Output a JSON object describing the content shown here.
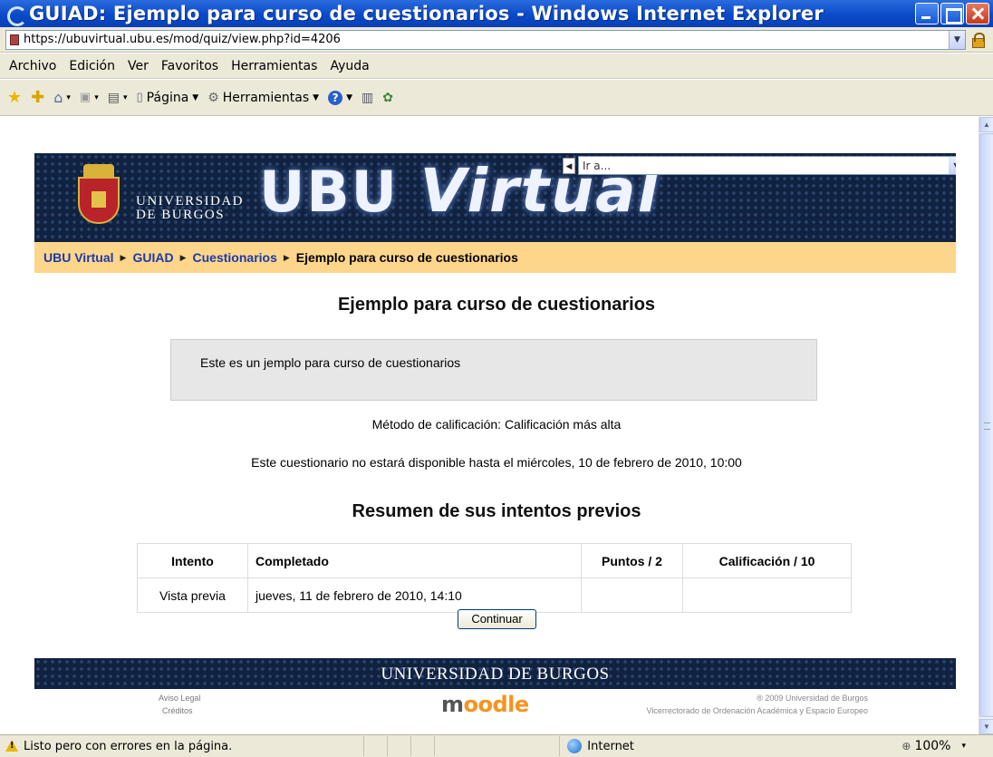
{
  "window": {
    "title": "GUIAD: Ejemplo para curso de cuestionarios - Windows Internet Explorer"
  },
  "address": {
    "url": "https://ubuvirtual.ubu.es/mod/quiz/view.php?id=4206"
  },
  "menu": [
    "Archivo",
    "Edición",
    "Ver",
    "Favoritos",
    "Herramientas",
    "Ayuda"
  ],
  "toolbar": {
    "page_label": "Página",
    "tools_label": "Herramientas"
  },
  "header": {
    "university_line1": "UNIVERSIDAD",
    "university_line2": "DE BURGOS",
    "logo_part1": "UBU",
    "logo_part2": "Virtual",
    "goto_placeholder": "Ir a..."
  },
  "breadcrumb": {
    "items": [
      "UBU Virtual",
      "GUIAD",
      "Cuestionarios"
    ],
    "current": "Ejemplo para curso de cuestionarios"
  },
  "quiz": {
    "title": "Ejemplo para curso de cuestionarios",
    "intro": "Este es un jemplo para curso de cuestionarios",
    "grading_method": "Método de calificación: Calificación más alta",
    "availability": "Este cuestionario no estará disponible hasta el miércoles, 10 de febrero de 2010, 10:00",
    "summary_title": "Resumen de sus intentos previos",
    "columns": [
      "Intento",
      "Completado",
      "Puntos / 2",
      "Calificación / 10"
    ],
    "rows": [
      {
        "attempt": "Vista previa",
        "completed": "jueves, 11 de febrero de 2010, 14:10",
        "points": "",
        "grade": ""
      }
    ],
    "continue_label": "Continuar"
  },
  "footer": {
    "band_title": "UNIVERSIDAD DE BURGOS",
    "legal": "Aviso Legal",
    "credits": "Créditos",
    "moodle_m": "m",
    "moodle_rest": "oodle",
    "copyright": "® 2009 Universidad de Burgos",
    "vicerrectorado": "Vicerrectorado de Ordenación Académica y Espacio Europeo"
  },
  "status": {
    "message": "Listo pero con errores en la página.",
    "zone": "Internet",
    "zoom": "100%"
  },
  "colors": {
    "accent": "#0a4ac8",
    "navbar": "#fdd68b",
    "header": "#112240",
    "link": "#1a3aa8"
  }
}
